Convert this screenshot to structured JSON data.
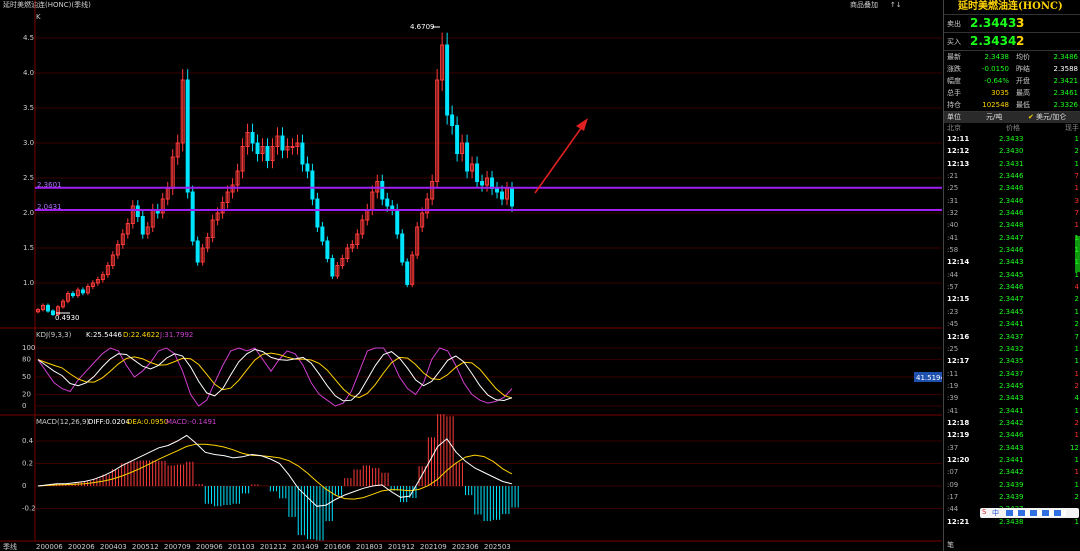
{
  "title": "延时美燃油连(HONC)(季线)",
  "top_links": [
    "商品叠加",
    "↑↓"
  ],
  "kline_label": "K",
  "price_axis": [
    "4.5",
    "4.0",
    "3.5",
    "3.0",
    "2.5",
    "2.0",
    "1.5",
    "1.0"
  ],
  "price_marks": {
    "high": "4.6709",
    "low": "0.4930",
    "line1": "2.3601",
    "line2": "2.0431"
  },
  "kdj_label": "KDJ(9,3,3)",
  "kdj_k": "K:25.5446",
  "kdj_d": "D:22.4622",
  "kdj_j": "J:31.7992",
  "kdj_axis": [
    "100",
    "80",
    "50",
    "20",
    "0"
  ],
  "kdj_tag": "41.5194",
  "macd_label": "MACD(12,26,9)",
  "macd_diff": "DIFF:0.0204",
  "macd_dea": "DEA:0.0950",
  "macd_val": "MACD:-0.1491",
  "macd_axis": [
    "0.4",
    "0.2",
    "0",
    "-0.2"
  ],
  "period_label": "季线",
  "x_axis": [
    "200006",
    "200206",
    "200403",
    "200512",
    "200709",
    "200906",
    "201103",
    "201212",
    "201409",
    "201606",
    "201803",
    "201912",
    "202109",
    "202306",
    "202503"
  ],
  "panel": {
    "name": "延时美燃油连(HONC)",
    "ask_label": "卖出",
    "ask_price": "2.3443",
    "ask_vol": "3",
    "bid_label": "买入",
    "bid_price": "2.3434",
    "bid_vol": "2",
    "stats": [
      {
        "k": "最新",
        "v": "2.3438",
        "c": "#1aff1a"
      },
      {
        "k": "均价",
        "v": "2.3486",
        "c": "#1aff1a"
      },
      {
        "k": "涨跌",
        "v": "-0.0150",
        "c": "#1aff1a"
      },
      {
        "k": "昨结",
        "v": "2.3588",
        "c": "#ffffff"
      },
      {
        "k": "幅度",
        "v": "-0.64%",
        "c": "#1aff1a"
      },
      {
        "k": "开盘",
        "v": "2.3421",
        "c": "#1aff1a"
      },
      {
        "k": "总手",
        "v": "3035",
        "c": "#ffd300"
      },
      {
        "k": "最高",
        "v": "2.3461",
        "c": "#1aff1a"
      },
      {
        "k": "持仓",
        "v": "102548",
        "c": "#ffd300"
      },
      {
        "k": "最低",
        "v": "2.3326",
        "c": "#1aff1a"
      }
    ],
    "unit_label": "单位",
    "unit_value": "元/吨",
    "currency": "美元/加仑",
    "col_time": "北京",
    "col_price": "价格",
    "col_qty": "现手",
    "ticks": [
      {
        "t": "12:11",
        "p": "2.3433",
        "q": "1",
        "big": true,
        "qc": "#1aff1a"
      },
      {
        "t": "12:12",
        "p": "2.3430",
        "q": "2",
        "big": true,
        "qc": "#1aff1a"
      },
      {
        "t": "12:13",
        "p": "2.3431",
        "q": "1",
        "big": true,
        "qc": "#1aff1a"
      },
      {
        "t": ":21",
        "p": "2.3446",
        "q": "7",
        "big": false,
        "qc": "#ff3030"
      },
      {
        "t": ":25",
        "p": "2.3446",
        "q": "1",
        "big": false,
        "qc": "#ff3030"
      },
      {
        "t": ":31",
        "p": "2.3446",
        "q": "3",
        "big": false,
        "qc": "#ff3030"
      },
      {
        "t": ":32",
        "p": "2.3446",
        "q": "7",
        "big": false,
        "qc": "#ff3030"
      },
      {
        "t": ":40",
        "p": "2.3448",
        "q": "1",
        "big": false,
        "qc": "#ff3030"
      },
      {
        "t": ":41",
        "p": "2.3447",
        "q": "1",
        "big": false,
        "qc": "#1aff1a"
      },
      {
        "t": ":58",
        "p": "2.3446",
        "q": "1",
        "big": false,
        "qc": "#1aff1a"
      },
      {
        "t": "12:14",
        "p": "2.3443",
        "q": "1",
        "big": true,
        "qc": "#1aff1a"
      },
      {
        "t": ":44",
        "p": "2.3445",
        "q": "1",
        "big": false,
        "qc": "#1aff1a"
      },
      {
        "t": ":57",
        "p": "2.3446",
        "q": "4",
        "big": false,
        "qc": "#ff3030"
      },
      {
        "t": "12:15",
        "p": "2.3447",
        "q": "2",
        "big": true,
        "qc": "#1aff1a"
      },
      {
        "t": ":23",
        "p": "2.3445",
        "q": "1",
        "big": false,
        "qc": "#1aff1a"
      },
      {
        "t": ":45",
        "p": "2.3441",
        "q": "2",
        "big": false,
        "qc": "#1aff1a"
      },
      {
        "t": "12:16",
        "p": "2.3437",
        "q": "7",
        "big": true,
        "qc": "#1aff1a"
      },
      {
        "t": ":25",
        "p": "2.3432",
        "q": "1",
        "big": false,
        "qc": "#1aff1a"
      },
      {
        "t": "12:17",
        "p": "2.3435",
        "q": "1",
        "big": true,
        "qc": "#1aff1a"
      },
      {
        "t": ":11",
        "p": "2.3437",
        "q": "1",
        "big": false,
        "qc": "#ff3030"
      },
      {
        "t": ":19",
        "p": "2.3445",
        "q": "2",
        "big": false,
        "qc": "#ff3030"
      },
      {
        "t": ":39",
        "p": "2.3443",
        "q": "4",
        "big": false,
        "qc": "#1aff1a"
      },
      {
        "t": ":41",
        "p": "2.3441",
        "q": "1",
        "big": false,
        "qc": "#1aff1a"
      },
      {
        "t": "12:18",
        "p": "2.3442",
        "q": "2",
        "big": true,
        "qc": "#ff3030"
      },
      {
        "t": "12:19",
        "p": "2.3446",
        "q": "1",
        "big": true,
        "qc": "#ff3030"
      },
      {
        "t": ":37",
        "p": "2.3443",
        "q": "12",
        "big": false,
        "qc": "#1aff1a"
      },
      {
        "t": "12:20",
        "p": "2.3441",
        "q": "1",
        "big": true,
        "qc": "#1aff1a"
      },
      {
        "t": ":07",
        "p": "2.3442",
        "q": "1",
        "big": false,
        "qc": "#ff3030"
      },
      {
        "t": ":09",
        "p": "2.3439",
        "q": "1",
        "big": false,
        "qc": "#1aff1a"
      },
      {
        "t": ":17",
        "p": "2.3439",
        "q": "2",
        "big": false,
        "qc": "#1aff1a"
      },
      {
        "t": ":44",
        "p": "2.3437",
        "q": "",
        "big": false,
        "qc": "#1aff1a"
      },
      {
        "t": "12:21",
        "p": "2.3438",
        "q": "1",
        "big": true,
        "qc": "#1aff1a"
      }
    ],
    "bottom_label": "笔",
    "ime_text": "中"
  },
  "colors": {
    "up": "#ff3b3b",
    "down": "#00e5ff",
    "kdj_k": "#ffffff",
    "kdj_d": "#ffd300",
    "kdj_j": "#d040d0",
    "hline": "#a020f0",
    "grid": "#3a0000",
    "arrow": "#e02020"
  }
}
